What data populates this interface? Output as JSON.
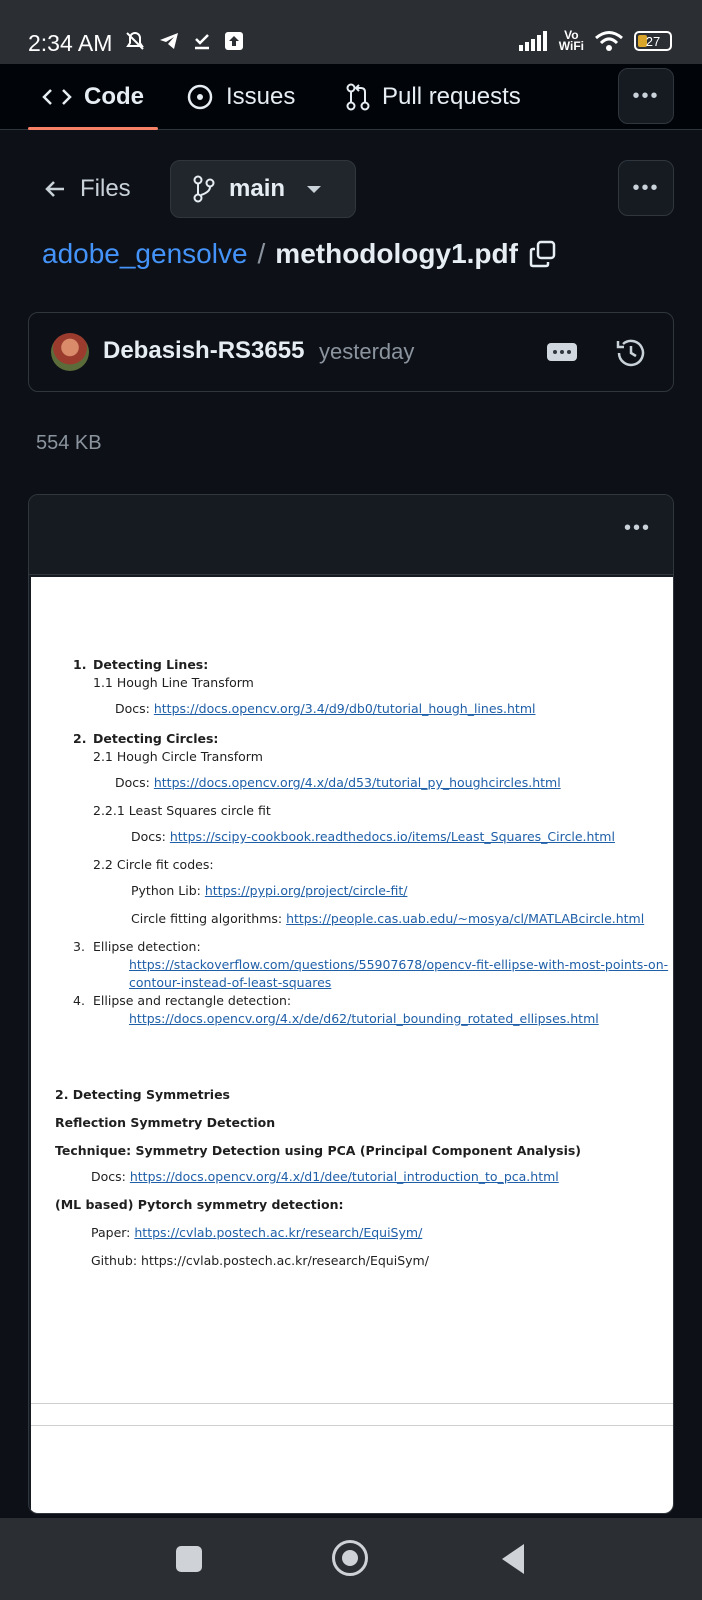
{
  "status_bar": {
    "time": "2:34 AM",
    "vowifi_top": "Vo",
    "vowifi_bottom": "WiFi",
    "battery": "27"
  },
  "tabs": [
    {
      "label": "Code",
      "icon": "code-icon",
      "active": true
    },
    {
      "label": "Issues",
      "icon": "issue-circle-icon",
      "active": false
    },
    {
      "label": "Pull requests",
      "icon": "pull-request-icon",
      "active": false
    }
  ],
  "files_label": "Files",
  "branch": "main",
  "breadcrumb": {
    "repo": "adobe_gensolve",
    "separator": "/",
    "file": "methodology1.pdf"
  },
  "commit": {
    "author": "Debasish-RS3655",
    "time": "yesterday"
  },
  "file_size": "554  KB",
  "pdf": {
    "l1_num": "1.",
    "l1_title": "Detecting Lines:",
    "l1_sub": "1.1 Hough Line Transform",
    "l1_docs_label": "Docs: ",
    "l1_docs_link": "https://docs.opencv.org/3.4/d9/db0/tutorial_hough_lines.html",
    "l2_num": "2.",
    "l2_title": "Detecting Circles:",
    "l2_sub": "2.1 Hough Circle Transform",
    "l2_docs_label": "Docs: ",
    "l2_docs_link": "https://docs.opencv.org/4.x/da/d53/tutorial_py_houghcircles.html",
    "l2_ls_title": "2.2.1 Least Squares circle fit",
    "l2_ls_docs_label": "Docs: ",
    "l2_ls_docs_link": "https://scipy-cookbook.readthedocs.io/items/Least_Squares_Circle.html",
    "l2_codes_title": "2.2 Circle fit codes:",
    "l2_pylib_label": "Python Lib: ",
    "l2_pylib_link": "https://pypi.org/project/circle-fit/",
    "l2_algo_label": "Circle fitting algorithms: ",
    "l2_algo_link": "https://people.cas.uab.edu/~mosya/cl/MATLABcircle.html",
    "l3_num": "3.",
    "l3_title": "Ellipse detection:",
    "l3_link_1": "https://stackoverflow.com/questions/55907678/opencv-fit-ellipse-with-most-points-on-",
    "l3_link_2": "contour-instead-of-least-squares",
    "l4_num": "4.",
    "l4_title": "Ellipse and rectangle detection:",
    "l4_link": "https://docs.opencv.org/4.x/de/d62/tutorial_bounding_rotated_ellipses.html",
    "s2_title": "2. Detecting Symmetries",
    "s2_reflection": "Reflection Symmetry Detection",
    "s2_technique": "Technique: Symmetry Detection using PCA (Principal Component Analysis)",
    "s2_docs_label": "Docs: ",
    "s2_docs_link": "https://docs.opencv.org/4.x/d1/dee/tutorial_introduction_to_pca.html",
    "s2_ml": "(ML based) Pytorch symmetry detection:",
    "s2_paper_label": "Paper: ",
    "s2_paper_link": "https://cvlab.postech.ac.kr/research/EquiSym/",
    "s2_github": "Github: https://cvlab.postech.ac.kr/research/EquiSym/"
  }
}
